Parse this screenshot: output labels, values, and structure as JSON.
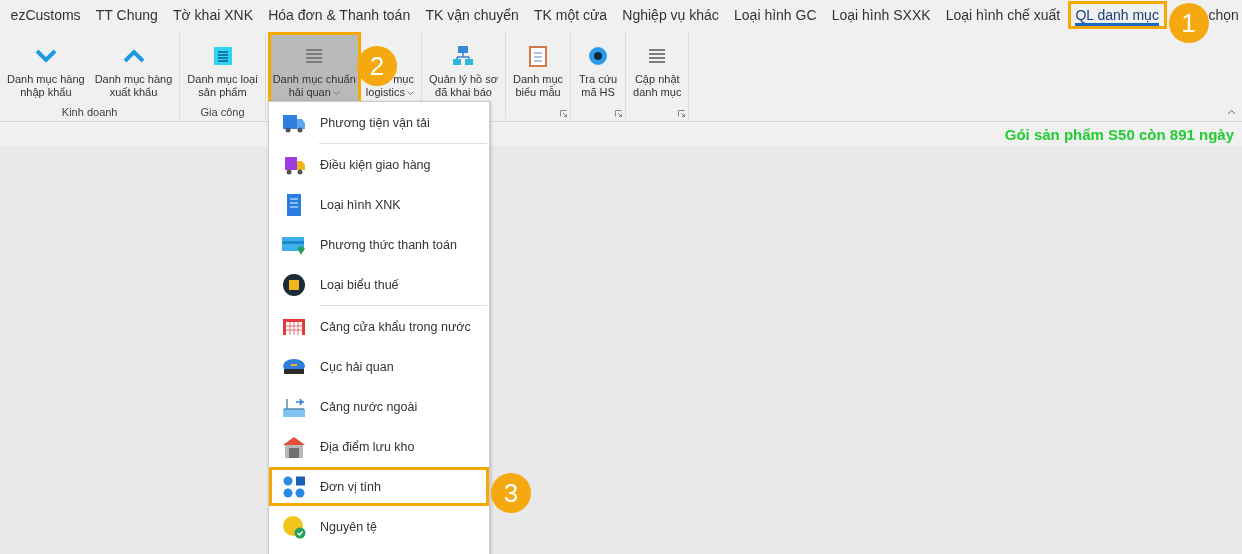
{
  "tabs": [
    {
      "label": "ezCustoms",
      "selected": false
    },
    {
      "label": "TT Chung",
      "selected": false
    },
    {
      "label": "Tờ khai XNK",
      "selected": false
    },
    {
      "label": "Hóa đơn & Thanh toán",
      "selected": false
    },
    {
      "label": "TK vận chuyển",
      "selected": false
    },
    {
      "label": "TK một cửa",
      "selected": false
    },
    {
      "label": "Nghiệp vụ khác",
      "selected": false
    },
    {
      "label": "Loại hình GC",
      "selected": false
    },
    {
      "label": "Loại hình SXXK",
      "selected": false
    },
    {
      "label": "Loại hình chế xuất",
      "selected": false
    },
    {
      "label": "QL danh mục",
      "selected": true,
      "callout": "1"
    },
    {
      "label": "chọn",
      "selected": false
    }
  ],
  "ribbon_groups": [
    {
      "label": "Kinh doanh",
      "launcher": false,
      "buttons": [
        {
          "kind": "chevron-down",
          "lines": [
            "Danh mục hàng",
            "nhập khẩu"
          ],
          "dropdown": false,
          "pressed": false
        },
        {
          "kind": "chevron-up",
          "lines": [
            "Danh mục hàng",
            "xuất khẩu"
          ],
          "dropdown": false,
          "pressed": false
        }
      ]
    },
    {
      "label": "Gia công",
      "launcher": false,
      "buttons": [
        {
          "kind": "list-box",
          "lines": [
            "Danh mục loại",
            "sản phẩm"
          ],
          "dropdown": false,
          "pressed": false
        }
      ]
    },
    {
      "launcher": false,
      "buttons": [
        {
          "kind": "lines",
          "lines": [
            "Danh mục chuẩn",
            "hải quan"
          ],
          "dropdown": true,
          "pressed": true,
          "callout": "2"
        },
        {
          "kind": "covered",
          "lines": [
            "mục",
            "logistics"
          ],
          "dropdown": true,
          "pressed": false
        }
      ]
    },
    {
      "launcher": false,
      "buttons": [
        {
          "kind": "network",
          "lines": [
            "Quản lý hồ sơ",
            "đã khai báo"
          ],
          "dropdown": false,
          "pressed": false
        }
      ]
    },
    {
      "launcher": true,
      "buttons": [
        {
          "kind": "clipboard",
          "lines": [
            "Danh mục",
            "biểu mẫu"
          ],
          "dropdown": false,
          "pressed": false
        }
      ]
    },
    {
      "launcher": true,
      "buttons": [
        {
          "kind": "eye",
          "lines": [
            "Tra cứu",
            "mã HS"
          ],
          "dropdown": false,
          "pressed": false
        }
      ]
    },
    {
      "launcher": true,
      "buttons": [
        {
          "kind": "lines",
          "lines": [
            "Cập nhật",
            "danh mục"
          ],
          "dropdown": false,
          "pressed": false
        }
      ]
    }
  ],
  "status": "Gói sản phẩm S50 còn 891 ngày",
  "menu": [
    {
      "kind": "truck",
      "label": "Phương tiện vận tải",
      "divider_after": true
    },
    {
      "kind": "fast-truck",
      "label": "Điều kiện giao hàng",
      "divider_after": false
    },
    {
      "kind": "server",
      "label": "Loại hình XNK",
      "divider_after": false
    },
    {
      "kind": "card",
      "label": "Phương thức thanh toán",
      "divider_after": false
    },
    {
      "kind": "dark-coin",
      "label": "Loại biểu thuế",
      "divider_after": true
    },
    {
      "kind": "gate",
      "label": "Cảng cửa khẩu trong nước",
      "divider_after": false
    },
    {
      "kind": "cap",
      "label": "Cục hải quan",
      "divider_after": false
    },
    {
      "kind": "airport",
      "label": "Cảng nước ngoài",
      "divider_after": false
    },
    {
      "kind": "warehouse",
      "label": "Địa điểm lưu kho",
      "divider_after": false
    },
    {
      "kind": "dots",
      "label": "Đơn vị tính",
      "divider_after": false,
      "callout": "3"
    },
    {
      "kind": "coin",
      "label": "Nguyên tệ",
      "divider_after": false
    }
  ]
}
